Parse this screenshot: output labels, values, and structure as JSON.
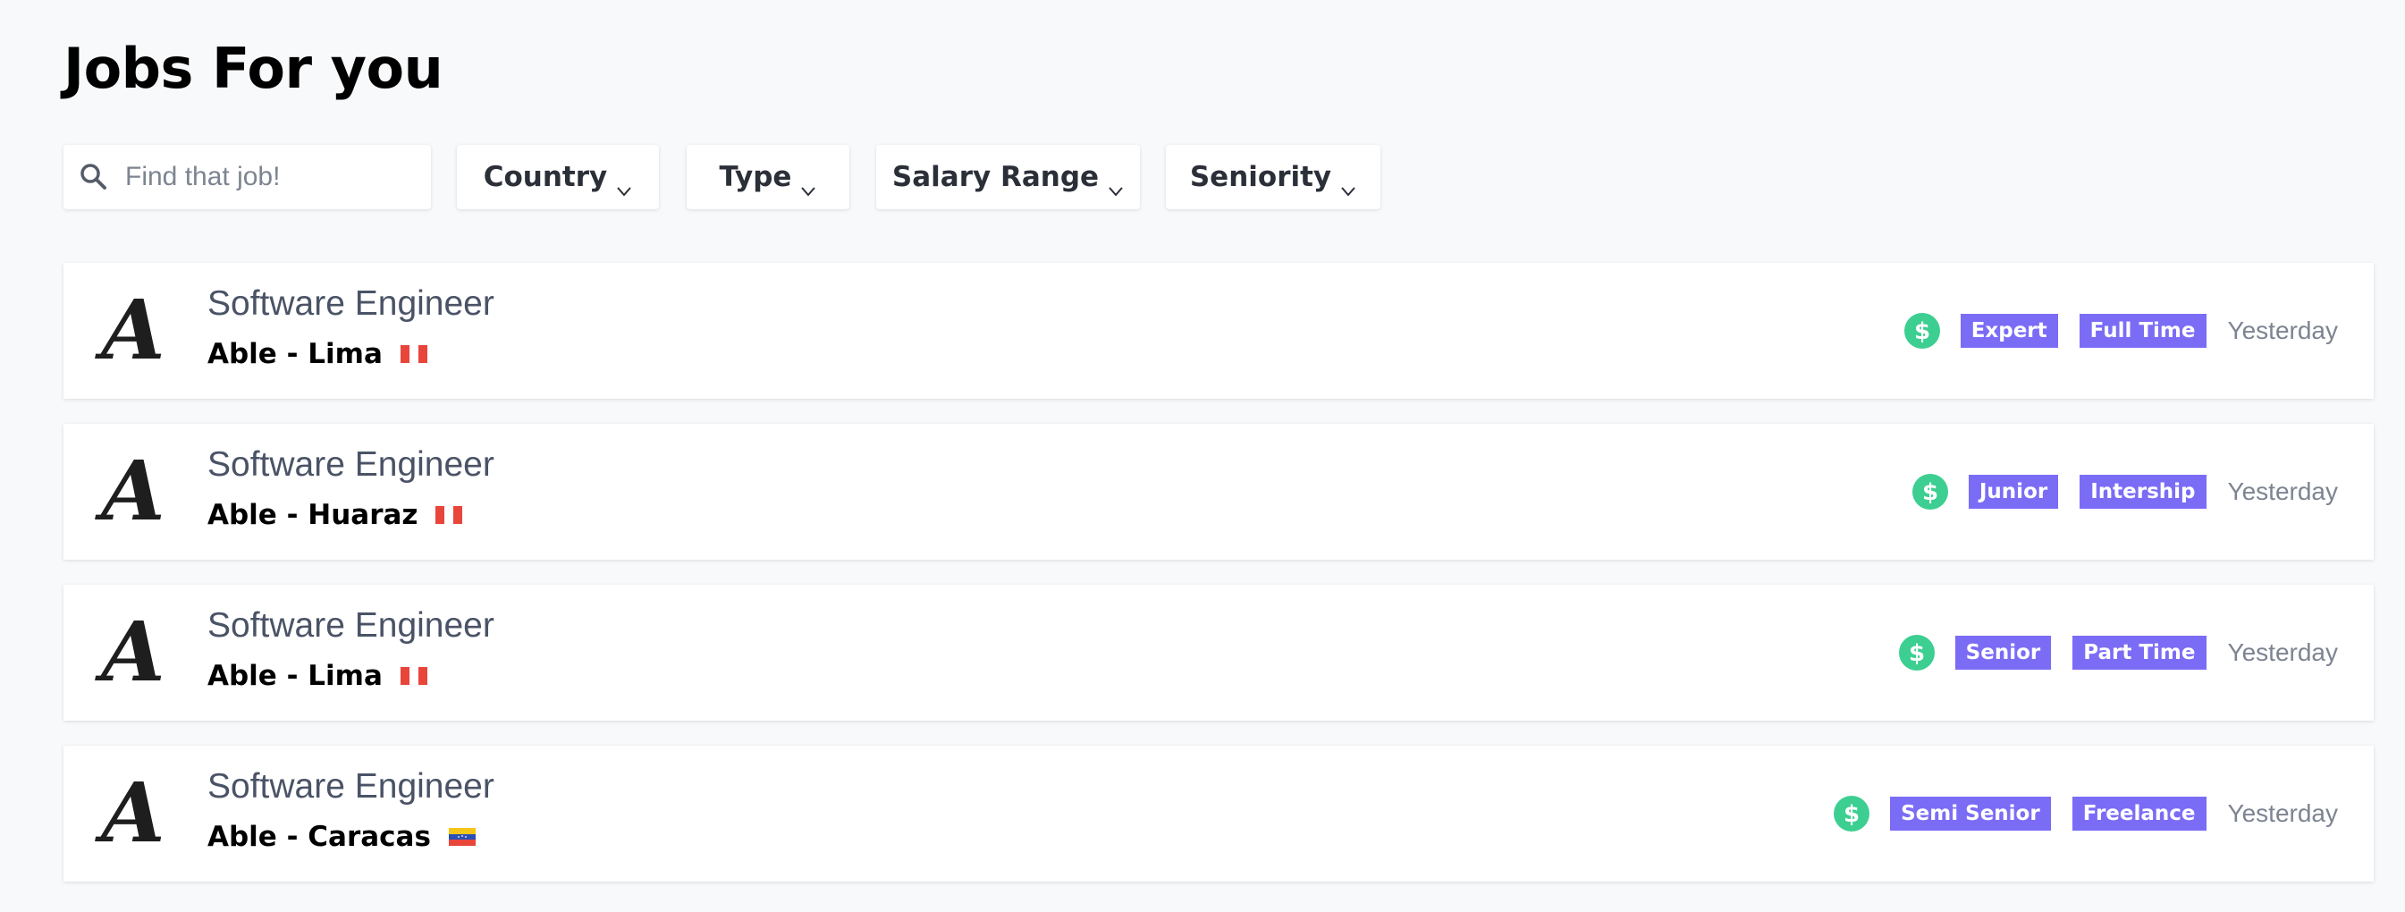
{
  "header": {
    "title": "Jobs For you"
  },
  "search": {
    "placeholder": "Find that job!",
    "value": ""
  },
  "filters": [
    {
      "label": "Country"
    },
    {
      "label": "Type"
    },
    {
      "label": "Salary Range"
    },
    {
      "label": "Seniority"
    }
  ],
  "jobs": [
    {
      "logo": "A",
      "title": "Software Engineer",
      "company": "Able - Lima",
      "flag": "peru-flag",
      "seniority": "Expert",
      "type": "Full Time",
      "posted": "Yesterday"
    },
    {
      "logo": "A",
      "title": "Software Engineer",
      "company": "Able - Huaraz",
      "flag": "peru-flag",
      "seniority": "Junior",
      "type": "Intership",
      "posted": "Yesterday"
    },
    {
      "logo": "A",
      "title": "Software Engineer",
      "company": "Able - Lima",
      "flag": "peru-flag",
      "seniority": "Senior",
      "type": "Part Time",
      "posted": "Yesterday"
    },
    {
      "logo": "A",
      "title": "Software Engineer",
      "company": "Able - Caracas",
      "flag": "venezuela-flag",
      "seniority": "Semi Senior",
      "type": "Freelance",
      "posted": "Yesterday"
    }
  ],
  "colors": {
    "tag": "#7b6cf6",
    "salary_icon": "#3ccf91",
    "title_text": "#4a5366",
    "date_text": "#7d8491"
  },
  "icons": {
    "search": "search-icon",
    "filter_chevron": "chevron-down-icon",
    "salary": "dollar-icon"
  }
}
